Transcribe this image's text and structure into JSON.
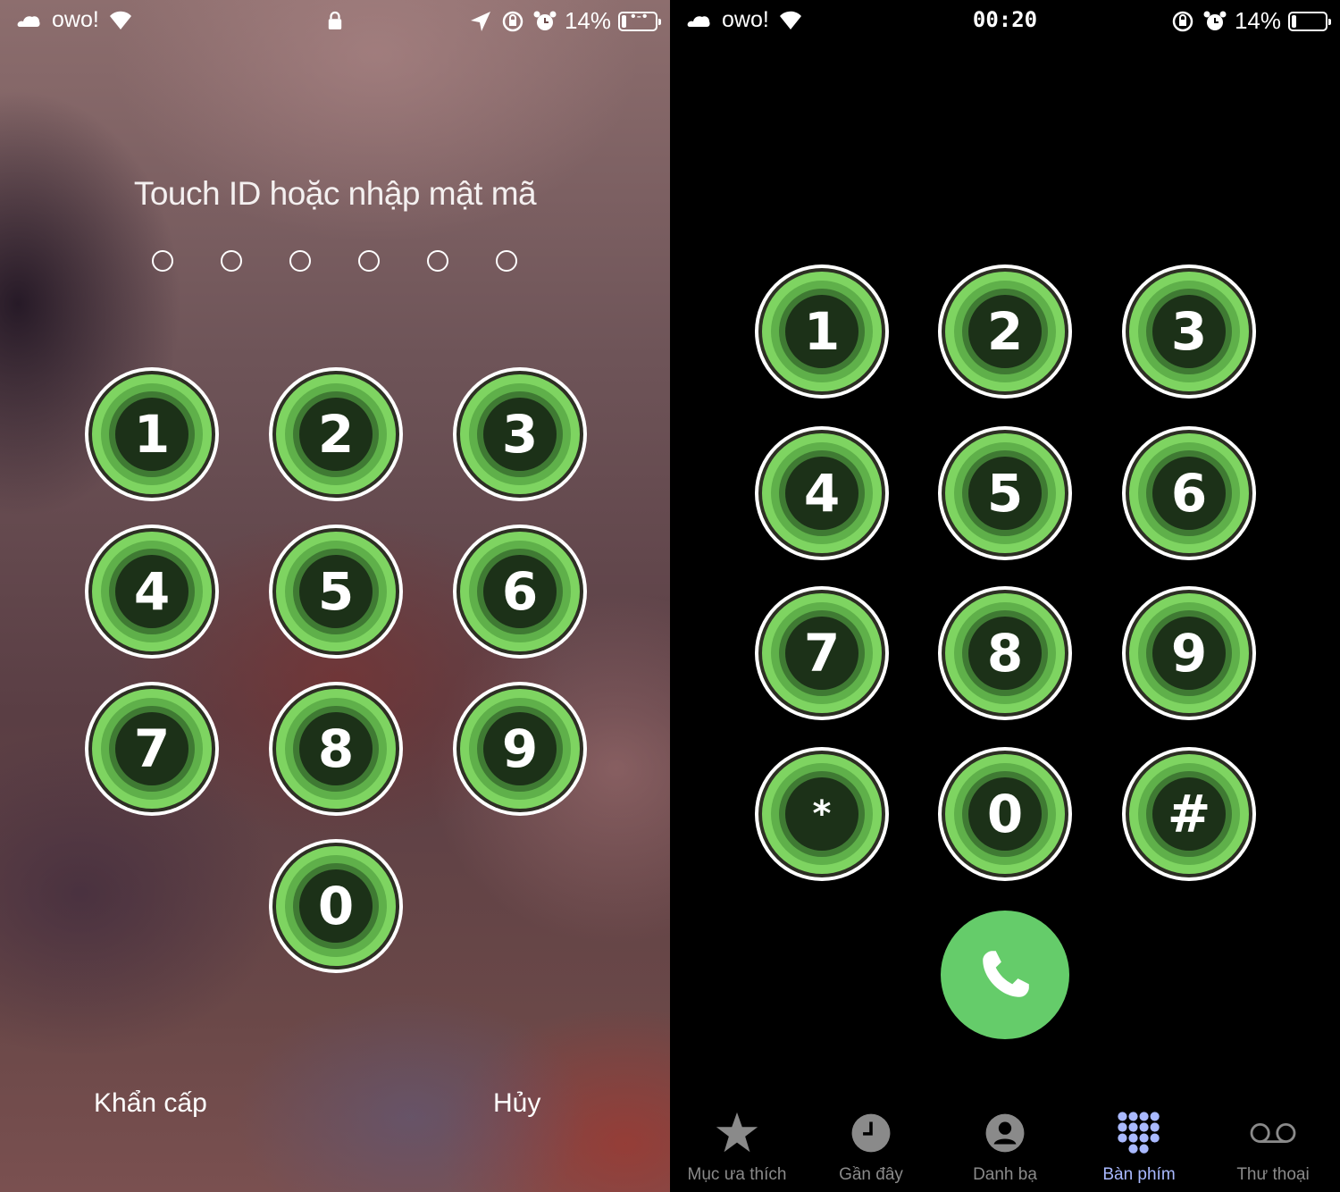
{
  "lock_screen": {
    "status_bar": {
      "carrier": "owo!",
      "battery_percent": "14%",
      "battery_level": 0.14
    },
    "prompt": "Touch ID hoặc nhập mật mã",
    "passcode_length": 6,
    "keys": [
      "1",
      "2",
      "3",
      "4",
      "5",
      "6",
      "7",
      "8",
      "9",
      "0"
    ],
    "emergency_label": "Khẩn cấp",
    "cancel_label": "Hủy"
  },
  "dialer": {
    "status_bar": {
      "carrier": "owo!",
      "time": "00:20",
      "battery_percent": "14%",
      "battery_level": 0.14
    },
    "keys": [
      "1",
      "2",
      "3",
      "4",
      "5",
      "6",
      "7",
      "8",
      "9",
      "*",
      "0",
      "#"
    ],
    "tabs": [
      {
        "label": "Mục ưa thích",
        "icon": "star-icon",
        "active": false
      },
      {
        "label": "Gần đây",
        "icon": "clock-icon",
        "active": false
      },
      {
        "label": "Danh bạ",
        "icon": "contact-icon",
        "active": false
      },
      {
        "label": "Bàn phím",
        "icon": "keypad-icon",
        "active": true
      },
      {
        "label": "Thư thoại",
        "icon": "voicemail-icon",
        "active": false
      }
    ]
  },
  "colors": {
    "key_outer": "#7ed461",
    "key_middle": "#5fb04a",
    "key_inner": "#3f7a33",
    "key_center": "#1c3118",
    "call_button": "#65cc6a",
    "tab_active": "#a9b9ff",
    "tab_inactive": "#8a8a8a"
  }
}
